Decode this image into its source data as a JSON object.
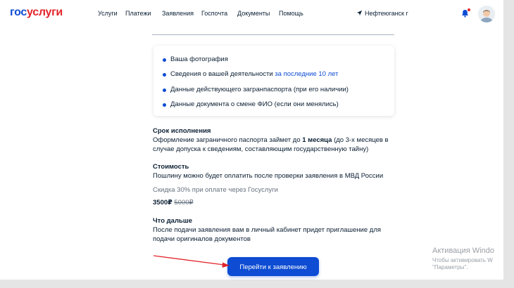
{
  "header": {
    "logo_part1": "гос",
    "logo_part2": "услуги",
    "nav": [
      "Услуги",
      "Платежи",
      "Заявления",
      "Госпочта",
      "Документы",
      "Помощь"
    ],
    "location": "Нефтеюганск г",
    "icons": [
      "location-arrow-icon",
      "bell-icon",
      "avatar"
    ]
  },
  "card": {
    "items": [
      {
        "text": "Ваша фотография"
      },
      {
        "text": "Сведения о вашей деятельности ",
        "link": "за последние 10 лет"
      },
      {
        "text": "Данные действующего загранпаспорта (при его наличии)"
      },
      {
        "text": "Данные документа о смене ФИО (если они менялись)"
      }
    ]
  },
  "deadline": {
    "title": "Срок исполнения",
    "line1_a": "Оформление заграничного паспорта займет до ",
    "line1_b": "1 месяца",
    "line1_c": " (до 3-х месяцев в",
    "line2": "случае допуска к сведениям, составляющим государственную тайну)"
  },
  "cost": {
    "title": "Стоимость",
    "line1": "Пошлину можно будет оплатить после проверки заявления в МВД России",
    "discount": "Скидка 30% при оплате через Госуслуги",
    "price": "3500₽",
    "old_price": "5000₽"
  },
  "next": {
    "title": "Что дальше",
    "line1": "После подачи заявления вам в личный кабинет придет приглашение для",
    "line2": "подачи оригиналов документов"
  },
  "cta": {
    "label": "Перейти к заявлению"
  },
  "annotation": {
    "arrow_color": "#e3242b"
  },
  "watermark": {
    "line1": "Активация Windo",
    "line2": "Чтобы активировать W",
    "line3": "\"Параметры\"."
  },
  "colors": {
    "brand_blue": "#0d4cd3",
    "brand_red": "#e3242b",
    "text": "#0b1f33"
  }
}
